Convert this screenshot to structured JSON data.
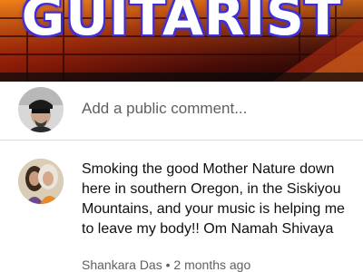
{
  "video": {
    "title_text": "GUITARIST",
    "progress_fraction": 0.09
  },
  "add_comment": {
    "placeholder": "Add a public comment..."
  },
  "comment": {
    "text": "Smoking the good Mother Nature down here in southern Oregon, in the Siskiyou Mountains, and your music is helping me to leave my body!! Om Namah Shivaya",
    "author": "Shankara Das",
    "separator": "•",
    "time": "2 months ago"
  },
  "colors": {
    "progress": "#ff0000",
    "placeholder": "#606060",
    "text": "#0f0f0f"
  }
}
